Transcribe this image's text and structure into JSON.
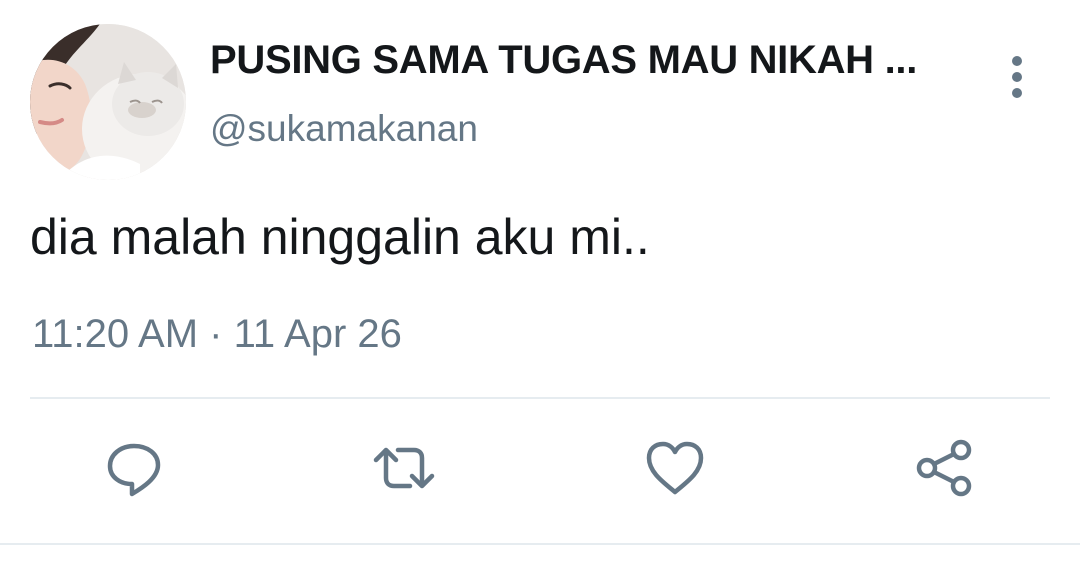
{
  "tweet": {
    "display_name": "PUSING SAMA TUGAS MAU NIKAH ...",
    "handle": "@sukamakanan",
    "text": "dia malah ninggalin aku mi..",
    "timestamp": "11:20 AM · 11 Apr 26"
  },
  "icons": {
    "more": "more-vertical-icon",
    "reply": "reply-icon",
    "retweet": "retweet-icon",
    "like": "heart-icon",
    "share": "share-icon"
  },
  "colors": {
    "text_primary": "#14171a",
    "text_secondary": "#657786",
    "divider": "#e6ecf0"
  }
}
